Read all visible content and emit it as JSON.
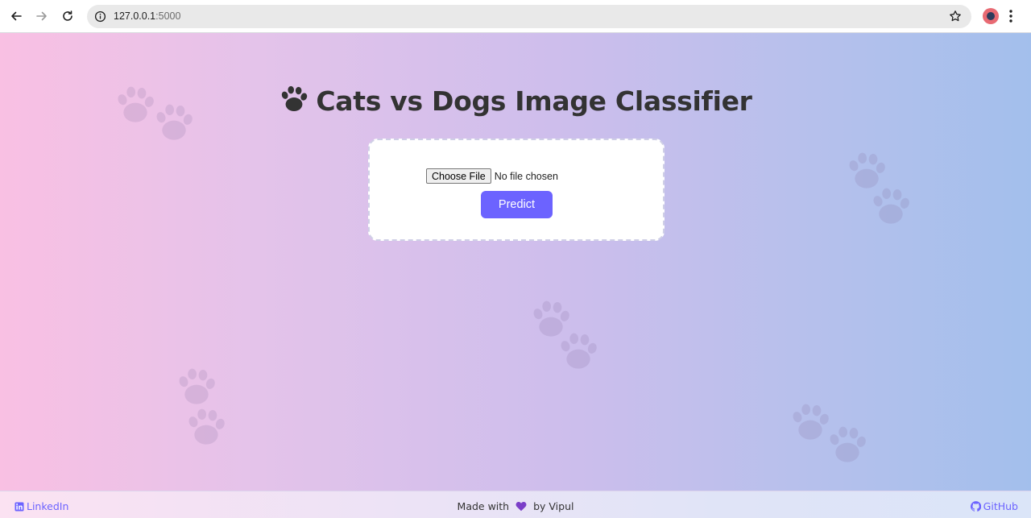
{
  "browser": {
    "url_host": "127.0.0.1",
    "url_port": ":5000"
  },
  "header": {
    "title": "Cats vs Dogs Image Classifier"
  },
  "upload": {
    "choose_label": "Choose File",
    "file_status": "No file chosen",
    "predict_label": "Predict"
  },
  "footer": {
    "linkedin_label": "LinkedIn",
    "made_prefix": "Made with",
    "made_suffix": "by Vipul",
    "github_label": "GitHub"
  },
  "colors": {
    "accent": "#6c63ff",
    "title": "#333333",
    "heart": "#7b3fc8"
  },
  "icons": {
    "title": "paw-icon",
    "decor": "paw-print-icon",
    "heart": "purple-heart-icon",
    "linkedin": "linkedin-icon",
    "github": "github-icon"
  }
}
